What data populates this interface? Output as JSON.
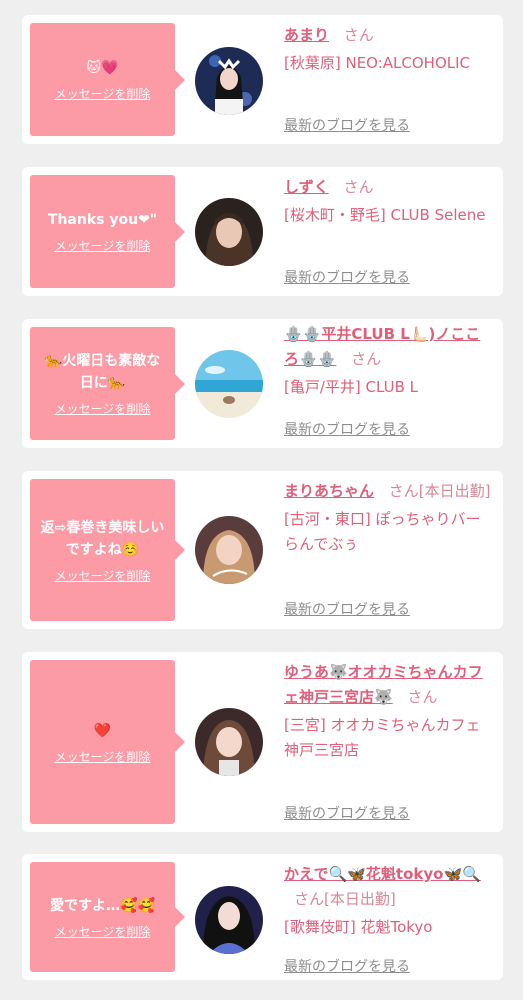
{
  "common": {
    "delete_label": "メッセージを削除",
    "blog_label": "最新のブログを見る"
  },
  "colors": {
    "bubble": "#fc9aa6",
    "name": "#e05f7a",
    "san": "#d98797",
    "link_gray": "#8e8e8e",
    "page_bg": "#f0eff0"
  },
  "items": [
    {
      "message": "🐱💗",
      "name": "あまり",
      "san": "さん",
      "shop": "[秋葉原] NEO:ALCOHOLIC"
    },
    {
      "message": "Thanks you❤\"",
      "name": "しずく",
      "san": "さん",
      "shop": "[桜木町・野毛] CLUB Selene"
    },
    {
      "message": "🐆火曜日も素敵な日に🐆",
      "name": "🪬🪬平井CLUB L🫷🏻)ノこころ🪬🪬",
      "san": "さん",
      "shop": "[亀戸/平井] CLUB L"
    },
    {
      "message": "返⇨春巻き美味しいですよね☺️",
      "name": "まりあちゃん",
      "san": "さん[本日出勤]",
      "shop": "[古河・東口] ぽっちゃりバー らんでぶぅ"
    },
    {
      "message": "❤️",
      "name": "ゆうあ🐺オオカミちゃんカフェ神戸三宮店🐺",
      "san": "さん",
      "shop": "[三宮] オオカミちゃんカフェ神戸三宮店"
    },
    {
      "message": "愛ですよ…🥰🥰",
      "name": "かえで🔍🦋花魁tokyo🦋🔍",
      "san": "さん[本日出勤]",
      "shop": "[歌舞伎町] 花魁Tokyo"
    }
  ]
}
